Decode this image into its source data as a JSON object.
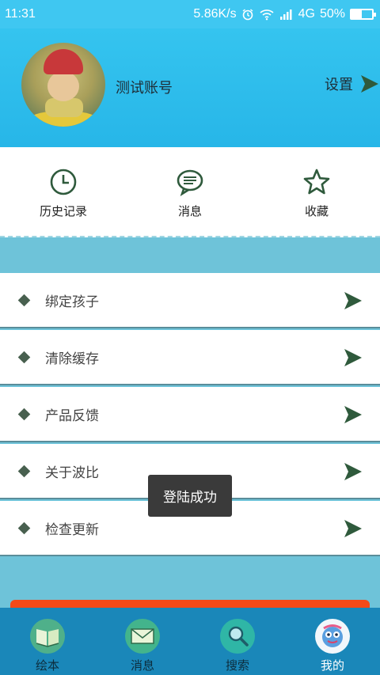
{
  "status": {
    "time": "11:31",
    "speed": "5.86K/s",
    "network": "4G",
    "battery": "50%",
    "battery_level": 0.5
  },
  "header": {
    "account_name": "测试账号",
    "settings_label": "设置"
  },
  "quick_actions": [
    {
      "label": "历史记录",
      "icon": "clock-icon"
    },
    {
      "label": "消息",
      "icon": "message-icon"
    },
    {
      "label": "收藏",
      "icon": "star-icon"
    }
  ],
  "menu": [
    {
      "label": "绑定孩子"
    },
    {
      "label": "清除缓存"
    },
    {
      "label": "产品反馈"
    },
    {
      "label": "关于波比"
    },
    {
      "label": "检查更新"
    }
  ],
  "toast": "登陆成功",
  "bottom_nav": [
    {
      "label": "绘本",
      "icon": "book-icon"
    },
    {
      "label": "消息",
      "icon": "envelope-icon"
    },
    {
      "label": "搜索",
      "icon": "magnifier-icon"
    },
    {
      "label": "我的",
      "icon": "profile-mascot-icon",
      "active": true
    }
  ],
  "colors": {
    "header": "#35c4ef",
    "accent_dark": "#2f5a3c",
    "toast_bg": "#3a3a3a",
    "nav_bg": "#1a87b9",
    "orange": "#f54a18"
  }
}
